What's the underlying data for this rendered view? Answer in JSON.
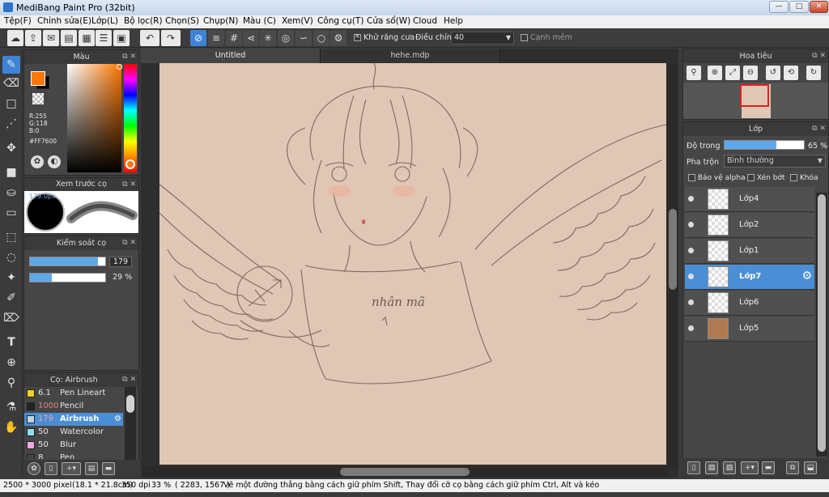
{
  "window": {
    "title": "MediBang Paint Pro (32bit)",
    "min_label": "—",
    "max_label": "□",
    "close_label": "✕"
  },
  "menu": [
    "Tệp(F)",
    "Chỉnh sửa(E)",
    "Lớp(L)",
    "Bộ lọc(R)",
    "Chọn(S)",
    "Chụp(N)",
    "Màu (C)",
    "Xem(V)",
    "Công cụ(T)",
    "Cửa sổ(W)",
    "Cloud",
    "Help"
  ],
  "toolbar": {
    "antialias_label": "Khử răng cưa",
    "correction_label": "Điều chỉnh",
    "correction_value": "40",
    "softedge_label": "Cạnh mềm"
  },
  "color_panel": {
    "title": "Màu",
    "r": "R:255",
    "g": "G:118",
    "b": "B:0",
    "hex": "#FF7600",
    "fg_color": "#ff7600"
  },
  "brush_preview": {
    "title": "Xem trước cọ",
    "size_label": "179.0px"
  },
  "brush_control": {
    "title": "Kiểm soát cọ",
    "size_value": "179",
    "size_fill": 0.9,
    "opacity_value": "29 %",
    "opacity_fill": 0.29
  },
  "brush_list": {
    "title": "Cọ: Airbrush",
    "items": [
      {
        "size": "6.1",
        "name": "Pen Lineart",
        "color": "#f0d020"
      },
      {
        "size": "1000",
        "name": "Pencil",
        "color": "#222222"
      },
      {
        "size": "179",
        "name": "Airbrush",
        "color": "#bfd3e6"
      },
      {
        "size": "50",
        "name": "Watercolor",
        "color": "#8fe0f0"
      },
      {
        "size": "50",
        "name": "Blur",
        "color": "#f0a8e8"
      },
      {
        "size": "8",
        "name": "Pen",
        "color": "#444444"
      }
    ]
  },
  "tabs": [
    "Untitled",
    "hehe.mdp"
  ],
  "navigator": {
    "title": "Hoa tiêu"
  },
  "layer_panel": {
    "title": "Lớp",
    "opacity_label": "Độ trong",
    "opacity_value": "65 %",
    "opacity_fill": 0.65,
    "blend_label": "Pha trộn",
    "blend_value": "Bình thường",
    "protect_alpha": "Bảo vệ alpha",
    "clipping": "Xén bớt",
    "lock": "Khóa",
    "layers": [
      {
        "name": "Lớp4",
        "selected": false,
        "fill": ""
      },
      {
        "name": "Lớp2",
        "selected": false,
        "fill": ""
      },
      {
        "name": "Lớp1",
        "selected": false,
        "fill": ""
      },
      {
        "name": "Lớp7",
        "selected": true,
        "fill": ""
      },
      {
        "name": "Lớp6",
        "selected": false,
        "fill": ""
      },
      {
        "name": "Lớp5",
        "selected": false,
        "fill": "#b07a50"
      }
    ]
  },
  "canvas": {
    "paper_color": "#e0c6b4"
  },
  "status": {
    "size": "2500 * 3000 pixel",
    "physical": "(18.1 * 21.8cm)",
    "dpi": "350 dpi",
    "zoom": "33 %",
    "coords": "( 2283, 1567 )",
    "hint": "Vẽ một đường thẳng bằng cách giữ phím Shift, Thay đổi cỡ cọ bằng cách giữ phím Ctrl, Alt và kéo"
  },
  "drawing_text": "nhân mã"
}
